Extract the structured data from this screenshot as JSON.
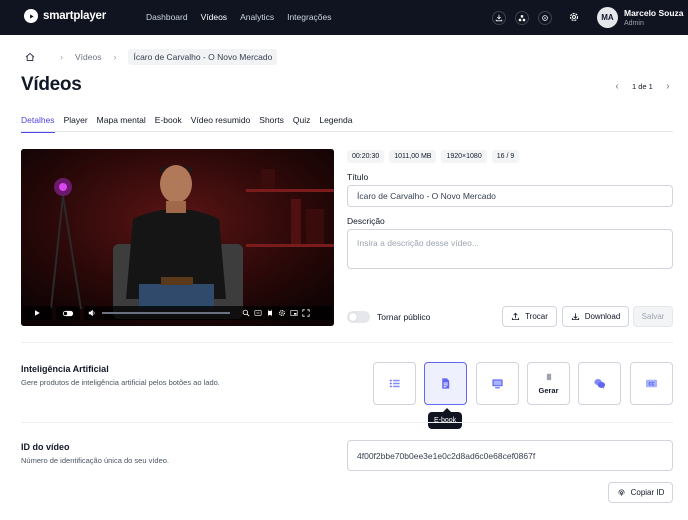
{
  "brand": {
    "name": "smartplayer"
  },
  "nav": {
    "items": [
      "Dashboard",
      "Vídeos",
      "Analytics",
      "Integrações"
    ],
    "active": "Vídeos"
  },
  "user": {
    "initials": "MA",
    "name": "Marcelo Souza",
    "role": "Admin"
  },
  "breadcrumb": {
    "section": "Vídeos",
    "current": "Ícaro de Carvalho - O Novo Mercado"
  },
  "page": {
    "title": "Vídeos",
    "pager": "1 de 1"
  },
  "tabs": [
    "Detalhes",
    "Player",
    "Mapa mental",
    "E-book",
    "Vídeo resumido",
    "Shorts",
    "Quiz",
    "Legenda"
  ],
  "video": {
    "duration": "00:20:30",
    "size": "1011,00 MB",
    "resolution": "1920×1080",
    "aspect": "16 / 9"
  },
  "form": {
    "title_label": "Título",
    "title_value": "Ícaro de Carvalho - O Novo Mercado",
    "description_label": "Descrição",
    "description_placeholder": "Insira a descrição desse vídeo...",
    "public_label": "Tornar público",
    "public_on": false
  },
  "actions": {
    "swap": "Trocar",
    "download": "Download",
    "save": "Salvar"
  },
  "ai": {
    "title": "Inteligência Artificial",
    "description": "Gere produtos de inteligência artificial pelos botões ao lado.",
    "buttons": [
      "mind-map",
      "e-book",
      "summary-video",
      "shorts",
      "quiz",
      "subtitles"
    ],
    "generate_label": "Gerar",
    "tooltip": "E-book"
  },
  "video_id": {
    "title": "ID do vídeo",
    "description": "Número de identificação única do seu vídeo.",
    "value": "4f00f2bbe70b0ee3e1e0c2d8ad6c0e68cef0867f",
    "copy_label": "Copiar ID"
  },
  "colors": {
    "accent": "#4f46e5",
    "topbar": "#0f1420"
  }
}
